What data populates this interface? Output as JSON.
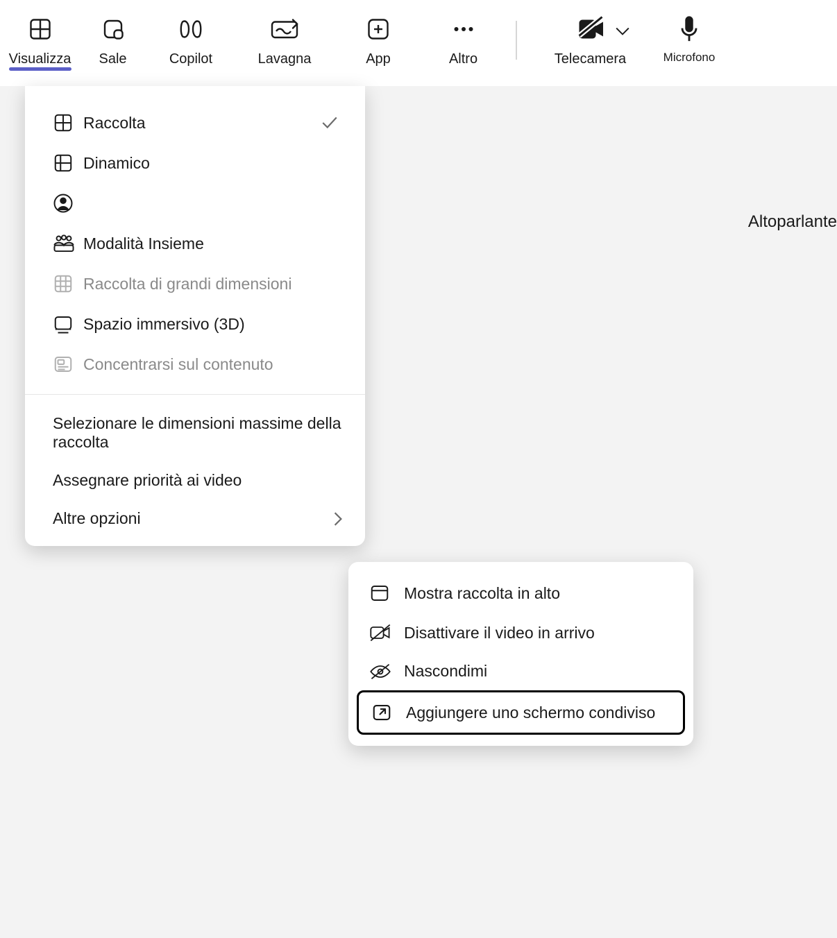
{
  "toolbar": {
    "visualizza": "Visualizza",
    "sale": "Sale",
    "copilot": "Copilot",
    "lavagna": "Lavagna",
    "app": "App",
    "altro": "Altro",
    "telecamera": "Telecamera",
    "microfono": "Microfono"
  },
  "content": {
    "speaker": "Altoparlante"
  },
  "dropdown": {
    "raccolta": "Raccolta",
    "dinamico": "Dinamico",
    "modalita_insieme": "Modalità Insieme",
    "raccolta_grandi": "Raccolta di grandi dimensioni",
    "spazio_3d": "Spazio immersivo (3D)",
    "concentrarsi": "Concentrarsi sul contenuto",
    "sel_dim": "Selezionare le dimensioni massime della raccolta",
    "priorita_video": "Assegnare priorità ai video",
    "altre_opzioni": "Altre opzioni"
  },
  "submenu": {
    "mostra_alto": "Mostra raccolta in alto",
    "disattiva_video": "Disattivare il video in arrivo",
    "nascondimi": "Nascondimi",
    "aggiungere_schermo": "Aggiungere uno schermo condiviso"
  }
}
